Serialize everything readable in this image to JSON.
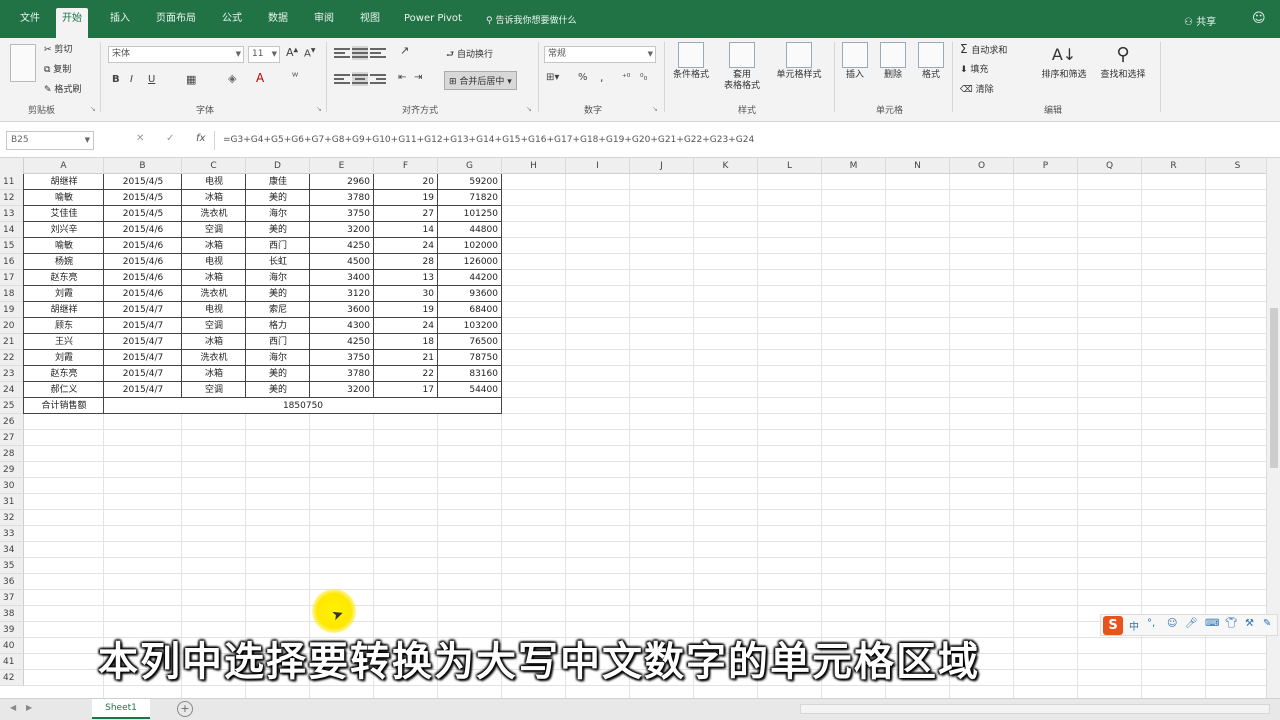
{
  "tabs": [
    {
      "label": "文件",
      "active": false
    },
    {
      "label": "开始",
      "active": true
    },
    {
      "label": "插入",
      "active": false
    },
    {
      "label": "页面布局",
      "active": false
    },
    {
      "label": "公式",
      "active": false
    },
    {
      "label": "数据",
      "active": false
    },
    {
      "label": "审阅",
      "active": false
    },
    {
      "label": "视图",
      "active": false
    },
    {
      "label": "Power Pivot",
      "active": false
    }
  ],
  "tell_me": "告诉我你想要做什么",
  "share": "共享",
  "ribbon": {
    "clipboard": {
      "cut": "剪切",
      "copy": "复制",
      "format_painter": "格式刷",
      "label": "剪贴板"
    },
    "font": {
      "name": "宋体",
      "size": "11",
      "label": "字体",
      "bold": "B",
      "italic": "I",
      "underline": "U"
    },
    "alignment": {
      "wrap": "自动换行",
      "merge": "合并后居中",
      "label": "对齐方式"
    },
    "number": {
      "format": "常规",
      "label": "数字",
      "percent": "%",
      "comma": ","
    },
    "styles": {
      "conditional": "条件格式",
      "table": "套用表格格式",
      "table_line1": "套用",
      "table_line2": "表格格式",
      "cell_styles": "单元格样式",
      "label": "样式"
    },
    "cells": {
      "insert": "插入",
      "delete": "删除",
      "format": "格式",
      "label": "单元格"
    },
    "editing": {
      "autosum": "自动求和",
      "fill": "填充",
      "clear": "清除",
      "sort": "排序和筛选",
      "find": "查找和选择",
      "label": "编辑"
    }
  },
  "formula_bar": {
    "name_box": "B25",
    "fx": "fx",
    "formula": "=G3+G4+G5+G6+G7+G8+G9+G10+G11+G12+G13+G14+G15+G16+G17+G18+G19+G20+G21+G22+G23+G24"
  },
  "columns": [
    "A",
    "B",
    "C",
    "D",
    "E",
    "F",
    "G",
    "H",
    "I",
    "J",
    "K",
    "L",
    "M",
    "N",
    "O",
    "P",
    "Q",
    "R",
    "S"
  ],
  "rows": [
    "11",
    "12",
    "13",
    "14",
    "15",
    "16",
    "17",
    "18",
    "19",
    "20",
    "21",
    "22",
    "23",
    "24",
    "25",
    "26",
    "27",
    "28",
    "29",
    "30",
    "31",
    "32",
    "33",
    "34",
    "35",
    "36",
    "37",
    "38",
    "39",
    "40",
    "41",
    "42"
  ],
  "table": [
    [
      "胡继祥",
      "2015/4/5",
      "电视",
      "康佳",
      "2960",
      "20",
      "59200"
    ],
    [
      "喻敏",
      "2015/4/5",
      "冰箱",
      "美的",
      "3780",
      "19",
      "71820"
    ],
    [
      "艾佳佳",
      "2015/4/5",
      "洗衣机",
      "海尔",
      "3750",
      "27",
      "101250"
    ],
    [
      "刘兴辛",
      "2015/4/6",
      "空调",
      "美的",
      "3200",
      "14",
      "44800"
    ],
    [
      "喻敏",
      "2015/4/6",
      "冰箱",
      "西门",
      "4250",
      "24",
      "102000"
    ],
    [
      "杨婉",
      "2015/4/6",
      "电视",
      "长虹",
      "4500",
      "28",
      "126000"
    ],
    [
      "赵东亮",
      "2015/4/6",
      "冰箱",
      "海尔",
      "3400",
      "13",
      "44200"
    ],
    [
      "刘霞",
      "2015/4/6",
      "洗衣机",
      "美的",
      "3120",
      "30",
      "93600"
    ],
    [
      "胡继祥",
      "2015/4/7",
      "电视",
      "索尼",
      "3600",
      "19",
      "68400"
    ],
    [
      "顾东",
      "2015/4/7",
      "空调",
      "格力",
      "4300",
      "24",
      "103200"
    ],
    [
      "王兴",
      "2015/4/7",
      "冰箱",
      "西门",
      "4250",
      "18",
      "76500"
    ],
    [
      "刘霞",
      "2015/4/7",
      "洗衣机",
      "海尔",
      "3750",
      "21",
      "78750"
    ],
    [
      "赵东亮",
      "2015/4/7",
      "冰箱",
      "美的",
      "3780",
      "22",
      "83160"
    ],
    [
      "郝仁义",
      "2015/4/7",
      "空调",
      "美的",
      "3200",
      "17",
      "54400"
    ]
  ],
  "total_row": {
    "label": "合计销售额",
    "value": "1850750"
  },
  "sheet": {
    "name": "Sheet1",
    "add": "+"
  },
  "ime": {
    "logo": "S",
    "mode": "中"
  },
  "subtitle": "本列中选择要转换为大写中文数字的单元格区域"
}
